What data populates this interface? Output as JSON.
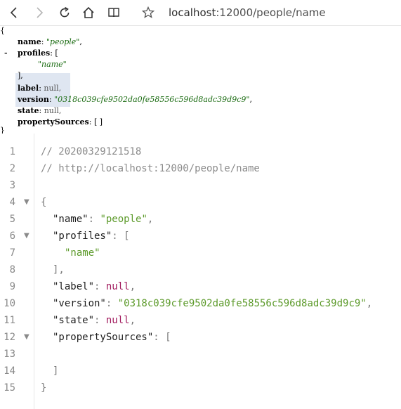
{
  "toolbar": {
    "url_host": "localhost",
    "url_port_path": ":12000/people/name"
  },
  "raw_json": {
    "open_brace": "{",
    "name_key": "name",
    "name_val": "\"people\"",
    "profiles_key": "profiles",
    "profiles_open": "[",
    "profiles_item": "\"name\"",
    "profiles_close": "],",
    "label_key": "label",
    "label_val": "null,",
    "version_key": "version",
    "version_val": "\"0318c039cfe9502da0fe58556c596d8adc39d9c9\"",
    "state_key": "state",
    "state_val": "null,",
    "ps_key": "propertySources",
    "ps_val": "[ ]",
    "close_brace": "}",
    "collapser": "-"
  },
  "editor": {
    "line_numbers": [
      "1",
      "2",
      "3",
      "4",
      "5",
      "6",
      "7",
      "8",
      "9",
      "10",
      "11",
      "12",
      "13",
      "14",
      "15"
    ],
    "comment1": "// 20200329121518",
    "comment2": "// http://localhost:12000/people/name",
    "open_brace": "{",
    "name_key": "\"name\"",
    "name_val": "\"people\"",
    "profiles_key": "\"profiles\"",
    "profiles_item": "\"name\"",
    "label_key": "\"label\"",
    "version_key": "\"version\"",
    "version_val": "\"0318c039cfe9502da0fe58556c596d8adc39d9c9\"",
    "state_key": "\"state\"",
    "ps_key": "\"propertySources\"",
    "null": "null",
    "close_bracket": "]",
    "close_brace": "}"
  }
}
